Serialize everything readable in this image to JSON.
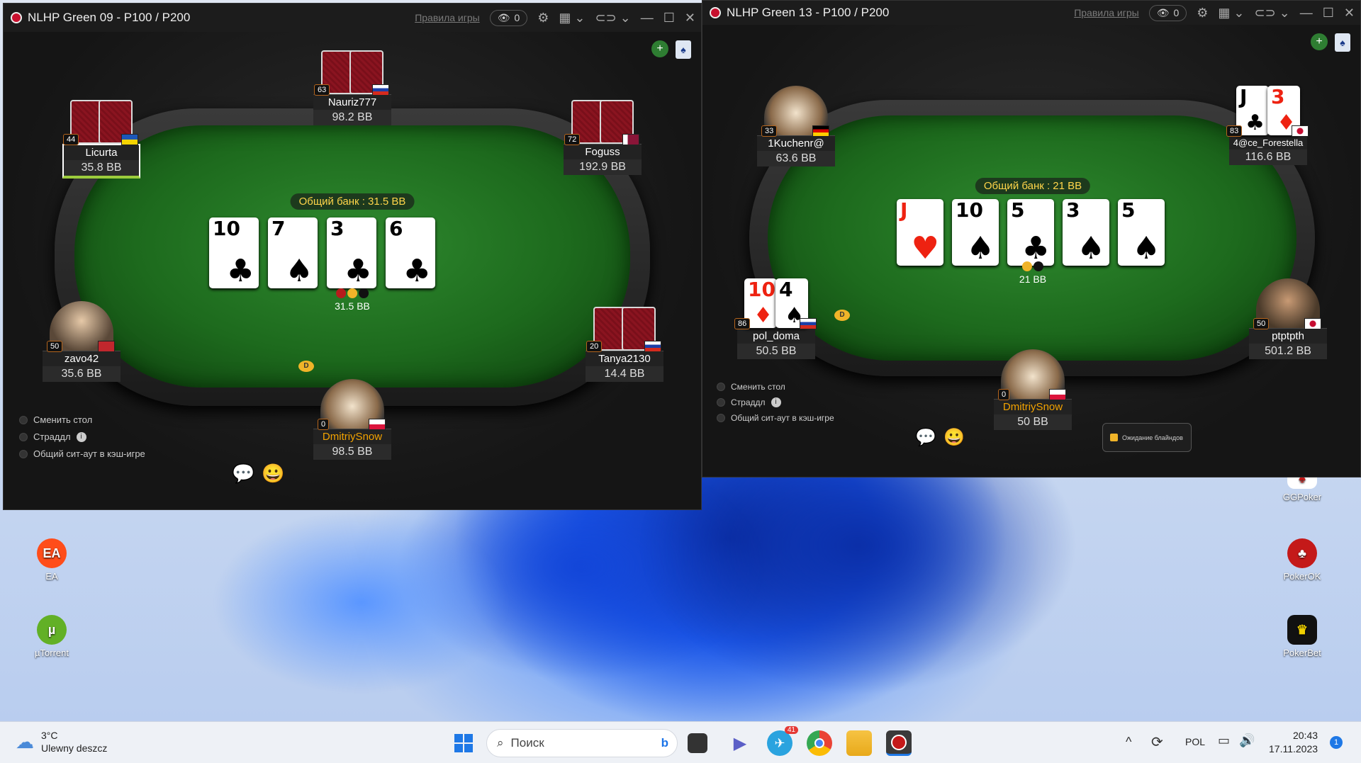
{
  "desktop": {
    "icons": [
      {
        "label": "EA",
        "icon": "ea-icon",
        "color": "#ff4d1a"
      },
      {
        "label": "µTorrent",
        "icon": "utorrent-icon",
        "color": "#62b026"
      },
      {
        "label": "GGPoker",
        "icon": "ggpoker-icon",
        "color": "#c41919"
      },
      {
        "label": "PokerOK",
        "icon": "pokerok-icon",
        "color": "#c41919"
      },
      {
        "label": "PokerBet",
        "icon": "pokerbet-icon",
        "color": "#111111"
      }
    ]
  },
  "window1": {
    "title": "NLHP Green 09 - P100 / P200",
    "rules_link": "Правила игры",
    "observers": "0",
    "pot": "Общий банк : 31.5 BB",
    "board": [
      {
        "rank": "10",
        "suit": "♣"
      },
      {
        "rank": "7",
        "suit": "♠"
      },
      {
        "rank": "3",
        "suit": "♣"
      },
      {
        "rank": "6",
        "suit": "♣"
      }
    ],
    "chips_amount": "31.5 BB",
    "players": [
      {
        "name": "Nauriz777",
        "stack": "98.2 BB",
        "level": "63",
        "flag": "ru"
      },
      {
        "name": "Licurta",
        "stack": "35.8 BB",
        "level": "44",
        "flag": "ua"
      },
      {
        "name": "Foguss",
        "stack": "192.9 BB",
        "level": "72",
        "flag": "qa"
      },
      {
        "name": "zavo42",
        "stack": "35.6 BB",
        "level": "50",
        "flag": "ma"
      },
      {
        "name": "Tanya2130",
        "stack": "14.4 BB",
        "level": "20",
        "flag": "ru"
      },
      {
        "name": "DmitriySnow",
        "stack": "98.5 BB",
        "level": "0",
        "flag": "pl"
      }
    ],
    "options": [
      "Сменить стол",
      "Страддл",
      "Общий сит-аут в кэш-игре"
    ],
    "dealer_label": "D"
  },
  "window2": {
    "title": "NLHP Green 13 - P100 / P200",
    "rules_link": "Правила игры",
    "observers": "0",
    "pot": "Общий банк : 21 BB",
    "board": [
      {
        "rank": "J",
        "suit": "♥"
      },
      {
        "rank": "10",
        "suit": "♠"
      },
      {
        "rank": "5",
        "suit": "♣"
      },
      {
        "rank": "3",
        "suit": "♠"
      },
      {
        "rank": "5",
        "suit": "♠"
      }
    ],
    "chips_amount": "21 BB",
    "players": [
      {
        "name": "1Kuchenr@",
        "stack": "63.6 BB",
        "level": "33",
        "flag": "de"
      },
      {
        "name": "4@ce_Forestella",
        "stack": "116.6 BB",
        "level": "83",
        "flag": "kr"
      },
      {
        "name": "pol_doma",
        "stack": "50.5 BB",
        "level": "86",
        "flag": "ru"
      },
      {
        "name": "ptptpth",
        "stack": "501.2 BB",
        "level": "50",
        "flag": "kr"
      },
      {
        "name": "DmitriySnow",
        "stack": "50 BB",
        "level": "0",
        "flag": "pl"
      }
    ],
    "shown_cards": {
      "forestella": [
        {
          "rank": "J",
          "suit": "♣"
        },
        {
          "rank": "3",
          "suit": "♦"
        }
      ],
      "pol_doma": [
        {
          "rank": "10",
          "suit": "♦"
        },
        {
          "rank": "4",
          "suit": "♠"
        }
      ]
    },
    "options": [
      "Сменить стол",
      "Страддл",
      "Общий сит-аут в кэш-игре"
    ],
    "waiting_label": "Ожидание блайндов",
    "dealer_label": "D"
  },
  "taskbar": {
    "weather_temp": "3°C",
    "weather_desc": "Ulewny deszcz",
    "search_placeholder": "Поиск",
    "telegram_badge": "41",
    "language": "POL",
    "time": "20:43",
    "date": "17.11.2023",
    "notification_count": "1"
  }
}
